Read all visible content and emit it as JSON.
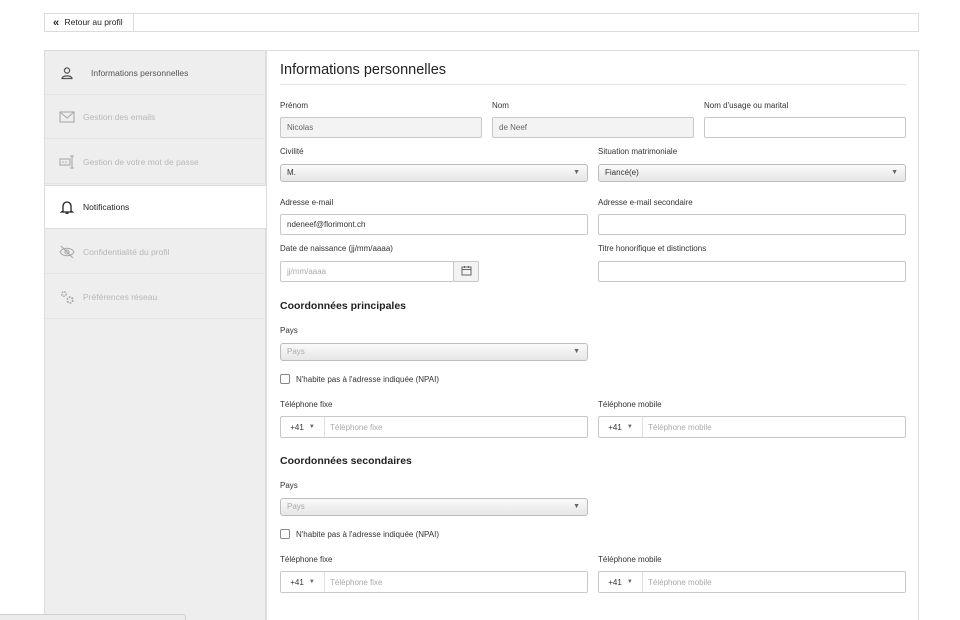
{
  "topbar": {
    "back_label": "Retour au profil"
  },
  "sidebar": {
    "items": [
      {
        "label": "Informations personnelles",
        "icon": "user-icon"
      },
      {
        "label": "Gestion des emails",
        "icon": "envelope-icon"
      },
      {
        "label": "Gestion de votre mot de passe",
        "icon": "password-field-icon"
      },
      {
        "label": "Notifications",
        "icon": "bell-icon"
      },
      {
        "label": "Confidentialité du profil",
        "icon": "eye-slash-icon"
      },
      {
        "label": "Préférences réseau",
        "icon": "gears-icon"
      }
    ]
  },
  "main": {
    "title": "Informations personnelles",
    "prenom": {
      "label": "Prénom",
      "value": "Nicolas"
    },
    "nom": {
      "label": "Nom",
      "value": "de Neef"
    },
    "nom_usage": {
      "label": "Nom d'usage ou marital",
      "value": ""
    },
    "civilite": {
      "label": "Civilité",
      "value": "M."
    },
    "situation": {
      "label": "Situation matrimoniale",
      "value": "Fiancé(e)"
    },
    "email": {
      "label": "Adresse e-mail",
      "value": "ndeneef@florimont.ch"
    },
    "email2": {
      "label": "Adresse e-mail secondaire",
      "value": ""
    },
    "naissance": {
      "label": "Date de naissance (jj/mm/aaaa)",
      "placeholder": "jj/mm/aaaa"
    },
    "titre": {
      "label": "Titre honorifique et distinctions",
      "value": ""
    },
    "coord_principales": {
      "title": "Coordonnées principales",
      "pays_label": "Pays",
      "pays_placeholder": "Pays",
      "npai_label": "N'habite pas à l'adresse indiquée (NPAI)",
      "tel_fixe_label": "Téléphone fixe",
      "tel_fixe_code": "+41",
      "tel_fixe_placeholder": "Téléphone fixe",
      "tel_mobile_label": "Téléphone mobile",
      "tel_mobile_code": "+41",
      "tel_mobile_placeholder": "Téléphone mobile"
    },
    "coord_secondaires": {
      "title": "Coordonnées secondaires",
      "pays_label": "Pays",
      "pays_placeholder": "Pays",
      "npai_label": "N'habite pas à l'adresse indiquée (NPAI)",
      "tel_fixe_label": "Téléphone fixe",
      "tel_fixe_code": "+41",
      "tel_fixe_placeholder": "Téléphone fixe",
      "tel_mobile_label": "Téléphone mobile",
      "tel_mobile_code": "+41",
      "tel_mobile_placeholder": "Téléphone mobile"
    }
  },
  "colors": {
    "sidebar_bg": "#eeeeee",
    "border": "#dcdcdc",
    "disabled_text": "#b8b8b8"
  }
}
